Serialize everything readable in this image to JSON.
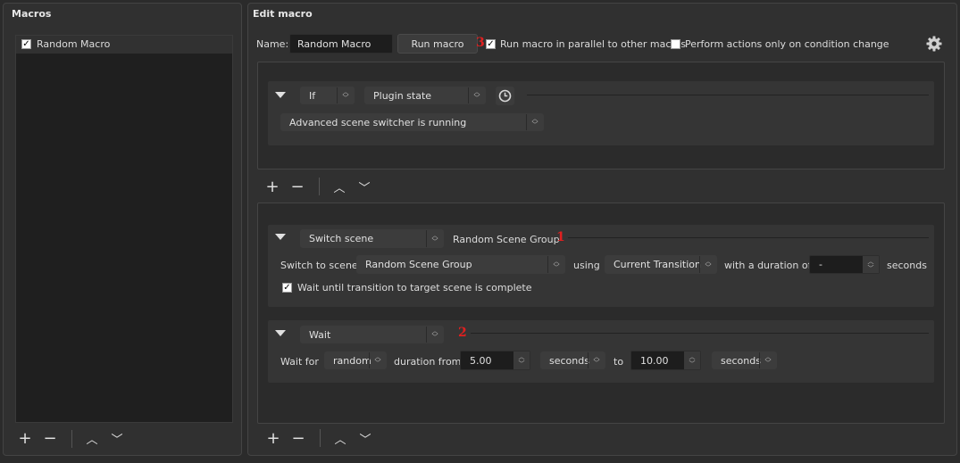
{
  "macros_panel": {
    "title": "Macros",
    "items": [
      {
        "label": "Random Macro",
        "checked": true
      }
    ],
    "toolbar": {
      "add": "+",
      "remove": "−",
      "up": "︿",
      "down": "﹀"
    }
  },
  "edit_panel": {
    "title": "Edit macro",
    "name_label": "Name:",
    "name_value": "Random Macro",
    "run_button": "Run macro",
    "run_parallel_label": "Run macro in parallel to other macros",
    "run_parallel_checked": true,
    "perform_on_change_label": "Perform actions only on condition change",
    "perform_on_change_checked": false,
    "annotation_3": "3"
  },
  "conditions": {
    "items": [
      {
        "logic": "If",
        "type": "Plugin state",
        "value": "Advanced scene switcher is running"
      }
    ],
    "toolbar": {
      "add": "+",
      "remove": "−",
      "up": "︿",
      "down": "﹀"
    }
  },
  "actions": {
    "switch_scene": {
      "type": "Switch scene",
      "summary": "Random Scene Group",
      "annotation": "1",
      "switch_to_label": "Switch to scene",
      "scene_value": "Random Scene Group",
      "using_label": "using",
      "transition_value": "Current Transition",
      "duration_label": "with a duration of",
      "duration_value": "-",
      "seconds_label": "seconds",
      "wait_label": "Wait until transition to target scene is complete",
      "wait_checked": true
    },
    "wait": {
      "type": "Wait",
      "annotation": "2",
      "wait_for_label": "Wait for",
      "mode_value": "random",
      "duration_from_label": "duration from",
      "from_value": "5.00",
      "from_unit": "seconds",
      "to_label": "to",
      "to_value": "10.00",
      "to_unit": "seconds"
    },
    "toolbar": {
      "add": "+",
      "remove": "−",
      "up": "︿",
      "down": "﹀"
    }
  },
  "colors": {
    "background": "#2b2b2b",
    "annotation": "#e02020"
  }
}
